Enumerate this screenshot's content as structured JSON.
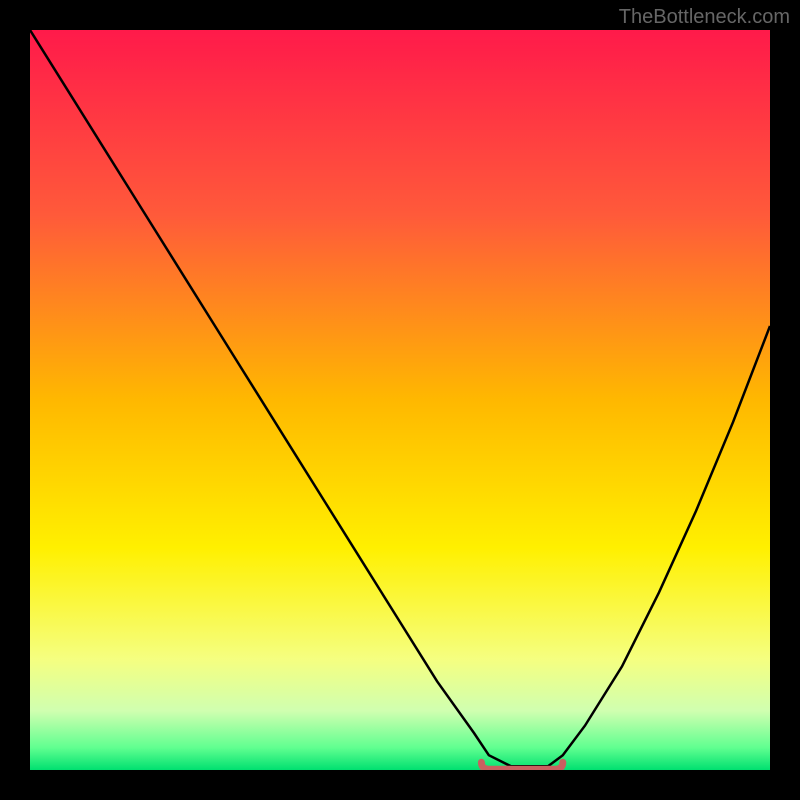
{
  "watermark": "TheBottleneck.com",
  "chart_data": {
    "type": "line",
    "title": "",
    "xlabel": "",
    "ylabel": "",
    "xlim": [
      0,
      100
    ],
    "ylim": [
      0,
      100
    ],
    "gradient_stops": [
      {
        "offset": 0,
        "color": "#ff1a4a"
      },
      {
        "offset": 25,
        "color": "#ff5a3a"
      },
      {
        "offset": 50,
        "color": "#ffb800"
      },
      {
        "offset": 70,
        "color": "#fff000"
      },
      {
        "offset": 85,
        "color": "#f5ff80"
      },
      {
        "offset": 92,
        "color": "#d0ffb0"
      },
      {
        "offset": 97,
        "color": "#60ff90"
      },
      {
        "offset": 100,
        "color": "#00e070"
      }
    ],
    "series": [
      {
        "name": "bottleneck-curve",
        "color": "#000000",
        "x": [
          0,
          5,
          10,
          15,
          20,
          25,
          30,
          35,
          40,
          45,
          50,
          55,
          60,
          62,
          65,
          68,
          70,
          72,
          75,
          80,
          85,
          90,
          95,
          100
        ],
        "y": [
          100,
          92,
          84,
          76,
          68,
          60,
          52,
          44,
          36,
          28,
          20,
          12,
          5,
          2,
          0.5,
          0.5,
          0.5,
          2,
          6,
          14,
          24,
          35,
          47,
          60
        ]
      }
    ],
    "marker": {
      "name": "optimal-region",
      "x_start": 61,
      "x_end": 72,
      "y": 0.5,
      "color": "#c96060"
    }
  }
}
